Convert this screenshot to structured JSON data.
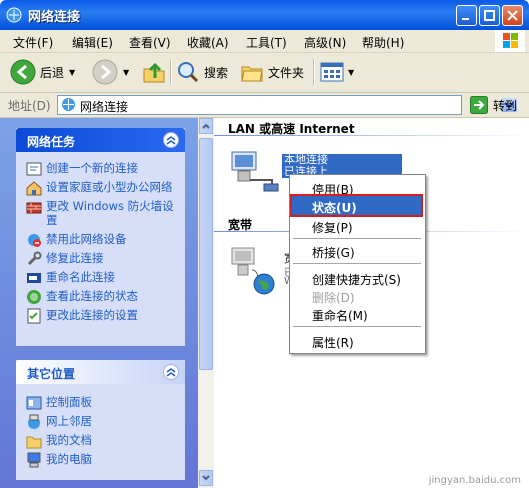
{
  "window": {
    "title": "网络连接"
  },
  "menu": [
    "文件(F)",
    "编辑(E)",
    "查看(V)",
    "收藏(A)",
    "工具(T)",
    "高级(N)",
    "帮助(H)"
  ],
  "toolbar": {
    "back": "后退",
    "search": "搜索",
    "folders": "文件夹"
  },
  "address": {
    "label": "地址(D)",
    "value": "网络连接",
    "go": "转到"
  },
  "network_tasks": {
    "title": "网络任务",
    "items": [
      {
        "label": "创建一个新的连接",
        "icon": "new-connection-icon"
      },
      {
        "label": "设置家庭或小型办公网络",
        "icon": "home-network-icon"
      },
      {
        "label": "更改 Windows 防火墙设置",
        "icon": "firewall-icon"
      },
      {
        "label": "禁用此网络设备",
        "icon": "disable-icon"
      },
      {
        "label": "修复此连接",
        "icon": "repair-icon"
      },
      {
        "label": "重命名此连接",
        "icon": "rename-icon"
      },
      {
        "label": "查看此连接的状态",
        "icon": "status-icon"
      },
      {
        "label": "更改此连接的设置",
        "icon": "settings-icon"
      }
    ]
  },
  "other_places": {
    "title": "其它位置",
    "items": [
      {
        "label": "控制面板",
        "icon": "control-panel-icon"
      },
      {
        "label": "网上邻居",
        "icon": "network-places-icon"
      },
      {
        "label": "我的文档",
        "icon": "my-documents-icon"
      },
      {
        "label": "我的电脑",
        "icon": "my-computer-icon"
      }
    ]
  },
  "groups": {
    "lan": "LAN 或高速 Internet",
    "broadband": "宽带"
  },
  "lan_connection": {
    "line1": "本地连接",
    "line2": "已连接上"
  },
  "broadband_connection": {
    "line1": "宽",
    "line2": "已",
    "line3": "W"
  },
  "context_menu": [
    {
      "label": "停用(B)",
      "state": "normal"
    },
    {
      "label": "状态(U)",
      "state": "selected"
    },
    {
      "label": "修复(P)",
      "state": "normal"
    },
    {
      "label": "桥接(G)",
      "state": "normal"
    },
    {
      "label": "创建快捷方式(S)",
      "state": "normal"
    },
    {
      "label": "删除(D)",
      "state": "disabled"
    },
    {
      "label": "重命名(M)",
      "state": "normal"
    },
    {
      "label": "属性(R)",
      "state": "normal"
    }
  ],
  "watermark": "jingyan.baidu.com"
}
